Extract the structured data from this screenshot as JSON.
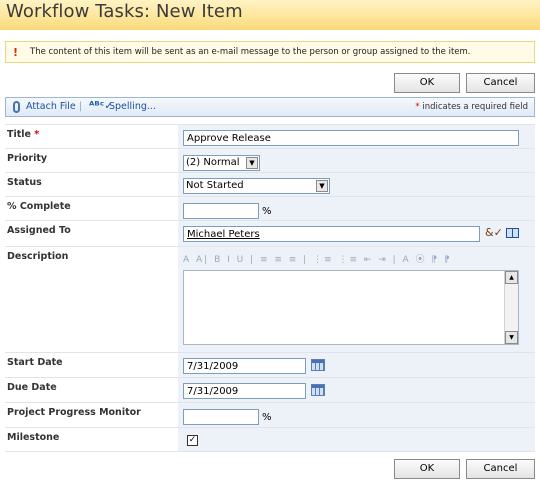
{
  "page": {
    "title": "Workflow Tasks: New Item"
  },
  "notice": {
    "text": "The content of this item will be sent as an e-mail message to the person or group assigned to the item."
  },
  "buttons": {
    "ok": "OK",
    "cancel": "Cancel"
  },
  "toolbar": {
    "attach_file": "Attach File",
    "separator": "|",
    "spelling": "Spelling...",
    "required_marker": "*",
    "required_text": "indicates a required field"
  },
  "form": {
    "title": {
      "label": "Title",
      "required_marker": "*",
      "value": "Approve Release"
    },
    "priority": {
      "label": "Priority",
      "value": "(2) Normal"
    },
    "status": {
      "label": "Status",
      "value": "Not Started"
    },
    "percent_complete": {
      "label": "% Complete",
      "value": "",
      "unit": "%"
    },
    "assigned_to": {
      "label": "Assigned To",
      "value": "Michael Peters"
    },
    "description": {
      "label": "Description",
      "value": "",
      "rte_toolbar": "A A| B I U | ≡ ≡ ≡ | ⋮≡ ⋮≡ ⇤ ⇥ | A ⦿ ⁋ ⁋"
    },
    "start_date": {
      "label": "Start Date",
      "value": "7/31/2009"
    },
    "due_date": {
      "label": "Due Date",
      "value": "7/31/2009"
    },
    "project_progress_monitor": {
      "label": "Project Progress Monitor",
      "value": "",
      "unit": "%"
    },
    "milestone": {
      "label": "Milestone",
      "checked": true,
      "check_glyph": "✓"
    }
  },
  "icons": {
    "dropdown": "▼",
    "scroll_up": "▲",
    "scroll_down": "▼",
    "warning": "!",
    "spelling": "ᴬᴮᶜ✓",
    "people_picker": "&✓"
  }
}
